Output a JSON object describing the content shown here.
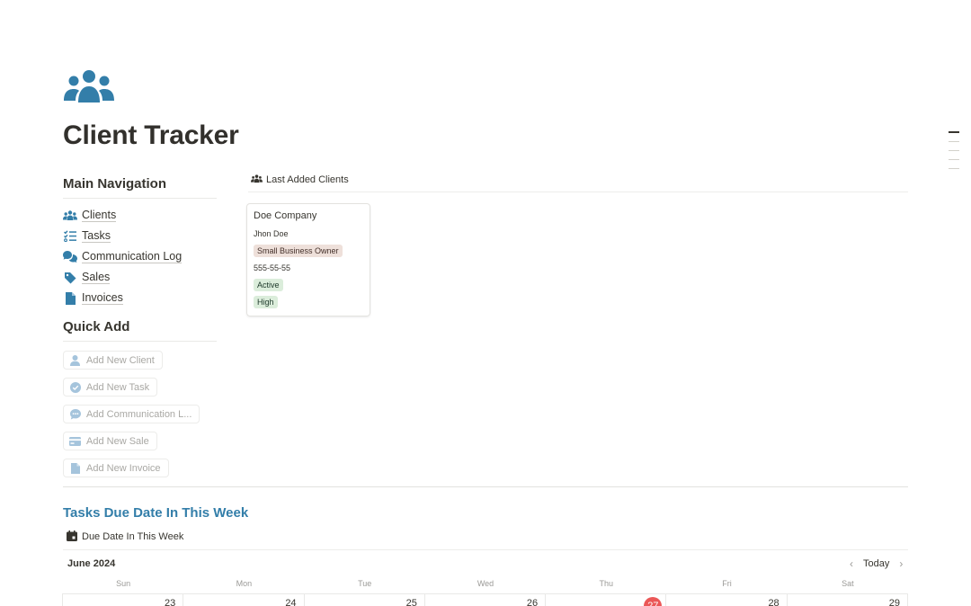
{
  "page": {
    "title": "Client Tracker",
    "icon": "people-group-icon",
    "accent_color": "#337ea9"
  },
  "main_navigation": {
    "heading": "Main Navigation",
    "items": [
      {
        "label": "Clients",
        "icon": "people-group-icon"
      },
      {
        "label": "Tasks",
        "icon": "checklist-icon"
      },
      {
        "label": "Communication Log",
        "icon": "chat-bubbles-icon"
      },
      {
        "label": "Sales",
        "icon": "tag-icon"
      },
      {
        "label": "Invoices",
        "icon": "document-icon"
      }
    ]
  },
  "quick_add": {
    "heading": "Quick Add",
    "buttons": [
      {
        "label": "Add New Client",
        "icon": "person-icon"
      },
      {
        "label": "Add New Task",
        "icon": "check-circle-icon"
      },
      {
        "label": "Add Communication L...",
        "icon": "chat-icon"
      },
      {
        "label": "Add New Sale",
        "icon": "credit-card-icon"
      },
      {
        "label": "Add New Invoice",
        "icon": "document-icon"
      }
    ]
  },
  "last_added": {
    "view_label": "Last Added Clients",
    "card": {
      "title": "Doe Company",
      "contact": "Jhon Doe",
      "type": "Small Business Owner",
      "phone": "555-55-55",
      "status": "Active",
      "priority": "High"
    }
  },
  "tasks_section": {
    "heading": "Tasks Due Date In This Week",
    "view_label": "Due Date In This Week",
    "calendar": {
      "month": "June 2024",
      "today_label": "Today",
      "weekdays": [
        "Sun",
        "Mon",
        "Tue",
        "Wed",
        "Thu",
        "Fri",
        "Sat"
      ],
      "days": [
        "23",
        "24",
        "25",
        "26",
        "27",
        "28",
        "29"
      ],
      "today_day": "27",
      "today_color": "#eb5757"
    }
  }
}
